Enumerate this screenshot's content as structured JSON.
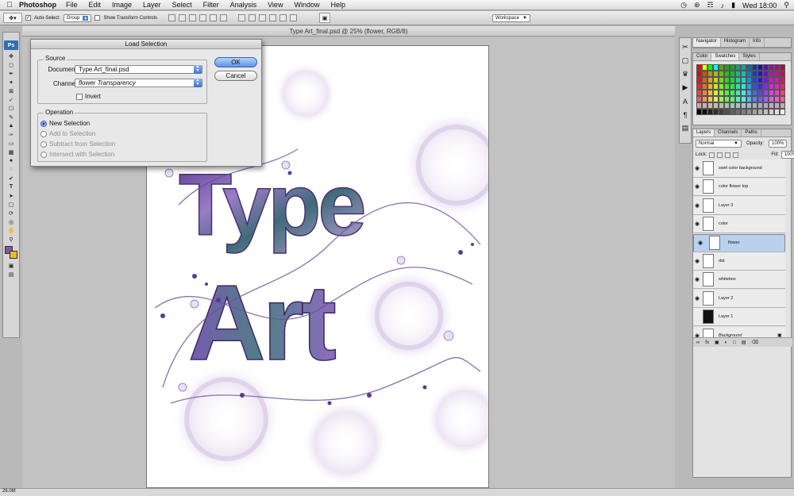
{
  "menubar": {
    "app": "Photoshop",
    "items": [
      "File",
      "Edit",
      "Image",
      "Layer",
      "Select",
      "Filter",
      "Analysis",
      "View",
      "Window",
      "Help"
    ],
    "clock": "Wed 18:00"
  },
  "options": {
    "auto_select": "Auto-Select:",
    "group_value": "Group",
    "show_transform": "Show Transform Controls",
    "workspace": "Workspace"
  },
  "document": {
    "title": "Type Art_final.psd @ 25% (flower, RGB/8)",
    "zoom": "26.0M"
  },
  "dialog": {
    "title": "Load Selection",
    "source_label": "Source",
    "document_label": "Document:",
    "document_value": "Type Art_final.psd",
    "channel_label": "Channel:",
    "channel_value": "flower Transparency",
    "invert_label": "Invert",
    "operation_label": "Operation",
    "operations": [
      "New Selection",
      "Add to Selection",
      "Subtract from Selection",
      "Intersect with Selection"
    ],
    "ok": "OK",
    "cancel": "Cancel"
  },
  "panels": {
    "nav_tabs": [
      "Navigator",
      "Histogram",
      "Info"
    ],
    "color_tabs": [
      "Color",
      "Swatches",
      "Styles"
    ],
    "layer_tabs": [
      "Layers",
      "Channels",
      "Paths"
    ],
    "blend_mode": "Normal",
    "opacity_label": "Opacity:",
    "opacity_value": "100%",
    "lock_label": "Lock:",
    "fill_label": "Fill:",
    "fill_value": "100%"
  },
  "layers": [
    {
      "name": "swirl color background",
      "selected": false
    },
    {
      "name": "color flower top",
      "selected": false
    },
    {
      "name": "Layer 3",
      "selected": false
    },
    {
      "name": "color",
      "selected": false
    },
    {
      "name": "flower",
      "selected": true
    },
    {
      "name": "dot",
      "selected": false
    },
    {
      "name": "whitebox",
      "selected": false
    },
    {
      "name": "Layer 2",
      "selected": false
    },
    {
      "name": "Layer 1",
      "selected": false
    },
    {
      "name": "Background",
      "selected": false
    }
  ],
  "artwork": {
    "line1": "Type",
    "line2": "Art"
  }
}
